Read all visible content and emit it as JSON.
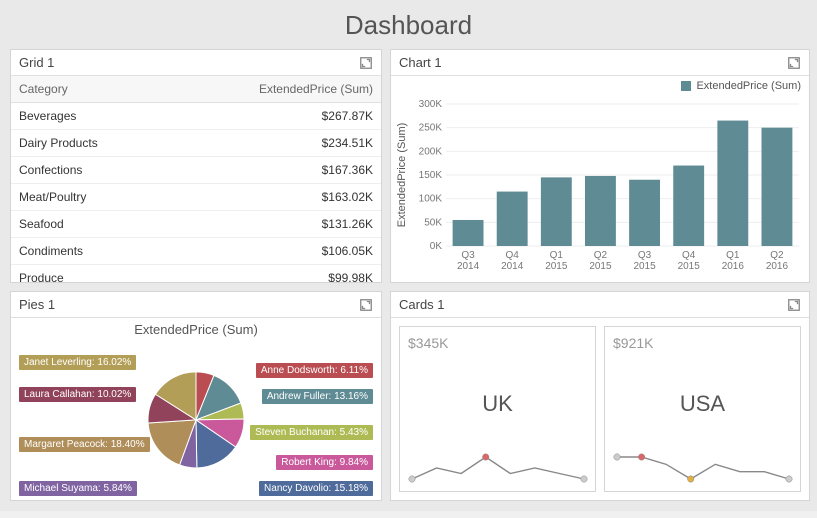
{
  "title": "Dashboard",
  "grid": {
    "title": "Grid 1",
    "columns": [
      "Category",
      "ExtendedPrice (Sum)"
    ],
    "rows": [
      {
        "category": "Beverages",
        "value": "$267.87K"
      },
      {
        "category": "Dairy Products",
        "value": "$234.51K"
      },
      {
        "category": "Confections",
        "value": "$167.36K"
      },
      {
        "category": "Meat/Poultry",
        "value": "$163.02K"
      },
      {
        "category": "Seafood",
        "value": "$131.26K"
      },
      {
        "category": "Condiments",
        "value": "$106.05K"
      },
      {
        "category": "Produce",
        "value": "$99.98K"
      }
    ]
  },
  "chart": {
    "title": "Chart 1",
    "legend": "ExtendedPrice (Sum)",
    "ylabel": "ExtendedPrice (Sum)"
  },
  "pies": {
    "title": "Pies 1",
    "subtitle": "ExtendedPrice (Sum)"
  },
  "cards": {
    "title": "Cards 1",
    "items": [
      {
        "value": "$345K",
        "label": "UK"
      },
      {
        "value": "$921K",
        "label": "USA"
      }
    ]
  },
  "chart_data": [
    {
      "type": "bar",
      "title": "ExtendedPrice (Sum) by Quarter",
      "categories": [
        "Q3 2014",
        "Q4 2014",
        "Q1 2015",
        "Q2 2015",
        "Q3 2015",
        "Q4 2015",
        "Q1 2016",
        "Q2 2016"
      ],
      "values": [
        55000,
        115000,
        145000,
        148000,
        140000,
        170000,
        265000,
        250000
      ],
      "ylabel": "ExtendedPrice (Sum)",
      "ylim": [
        0,
        300000
      ],
      "yticks": [
        "0K",
        "50K",
        "100K",
        "150K",
        "200K",
        "250K",
        "300K"
      ]
    },
    {
      "type": "pie",
      "title": "ExtendedPrice (Sum)",
      "series": [
        {
          "name": "Anne Dodsworth",
          "value": 6.11,
          "color": "#ba4d51"
        },
        {
          "name": "Andrew Fuller",
          "value": 13.16,
          "color": "#5f8b95"
        },
        {
          "name": "Steven Buchanan",
          "value": 5.43,
          "color": "#aebb54"
        },
        {
          "name": "Robert King",
          "value": 9.84,
          "color": "#c9599b"
        },
        {
          "name": "Nancy Davolio",
          "value": 15.18,
          "color": "#4e6b9c"
        },
        {
          "name": "Michael Suyama",
          "value": 5.84,
          "color": "#8064a2"
        },
        {
          "name": "Margaret Peacock",
          "value": 18.4,
          "color": "#af8e5a"
        },
        {
          "name": "Laura Callahan",
          "value": 10.02,
          "color": "#91435b"
        },
        {
          "name": "Janet Leverling",
          "value": 16.02,
          "color": "#b39e57"
        }
      ]
    },
    {
      "type": "line",
      "title": "UK sparkline",
      "x": [
        0,
        1,
        2,
        3,
        4,
        5,
        6,
        7
      ],
      "values": [
        10,
        12,
        11,
        14,
        11,
        12,
        11,
        10
      ]
    },
    {
      "type": "line",
      "title": "USA sparkline",
      "x": [
        0,
        1,
        2,
        3,
        4,
        5,
        6,
        7
      ],
      "values": [
        14,
        14,
        13,
        11,
        13,
        12,
        12,
        11
      ]
    }
  ]
}
